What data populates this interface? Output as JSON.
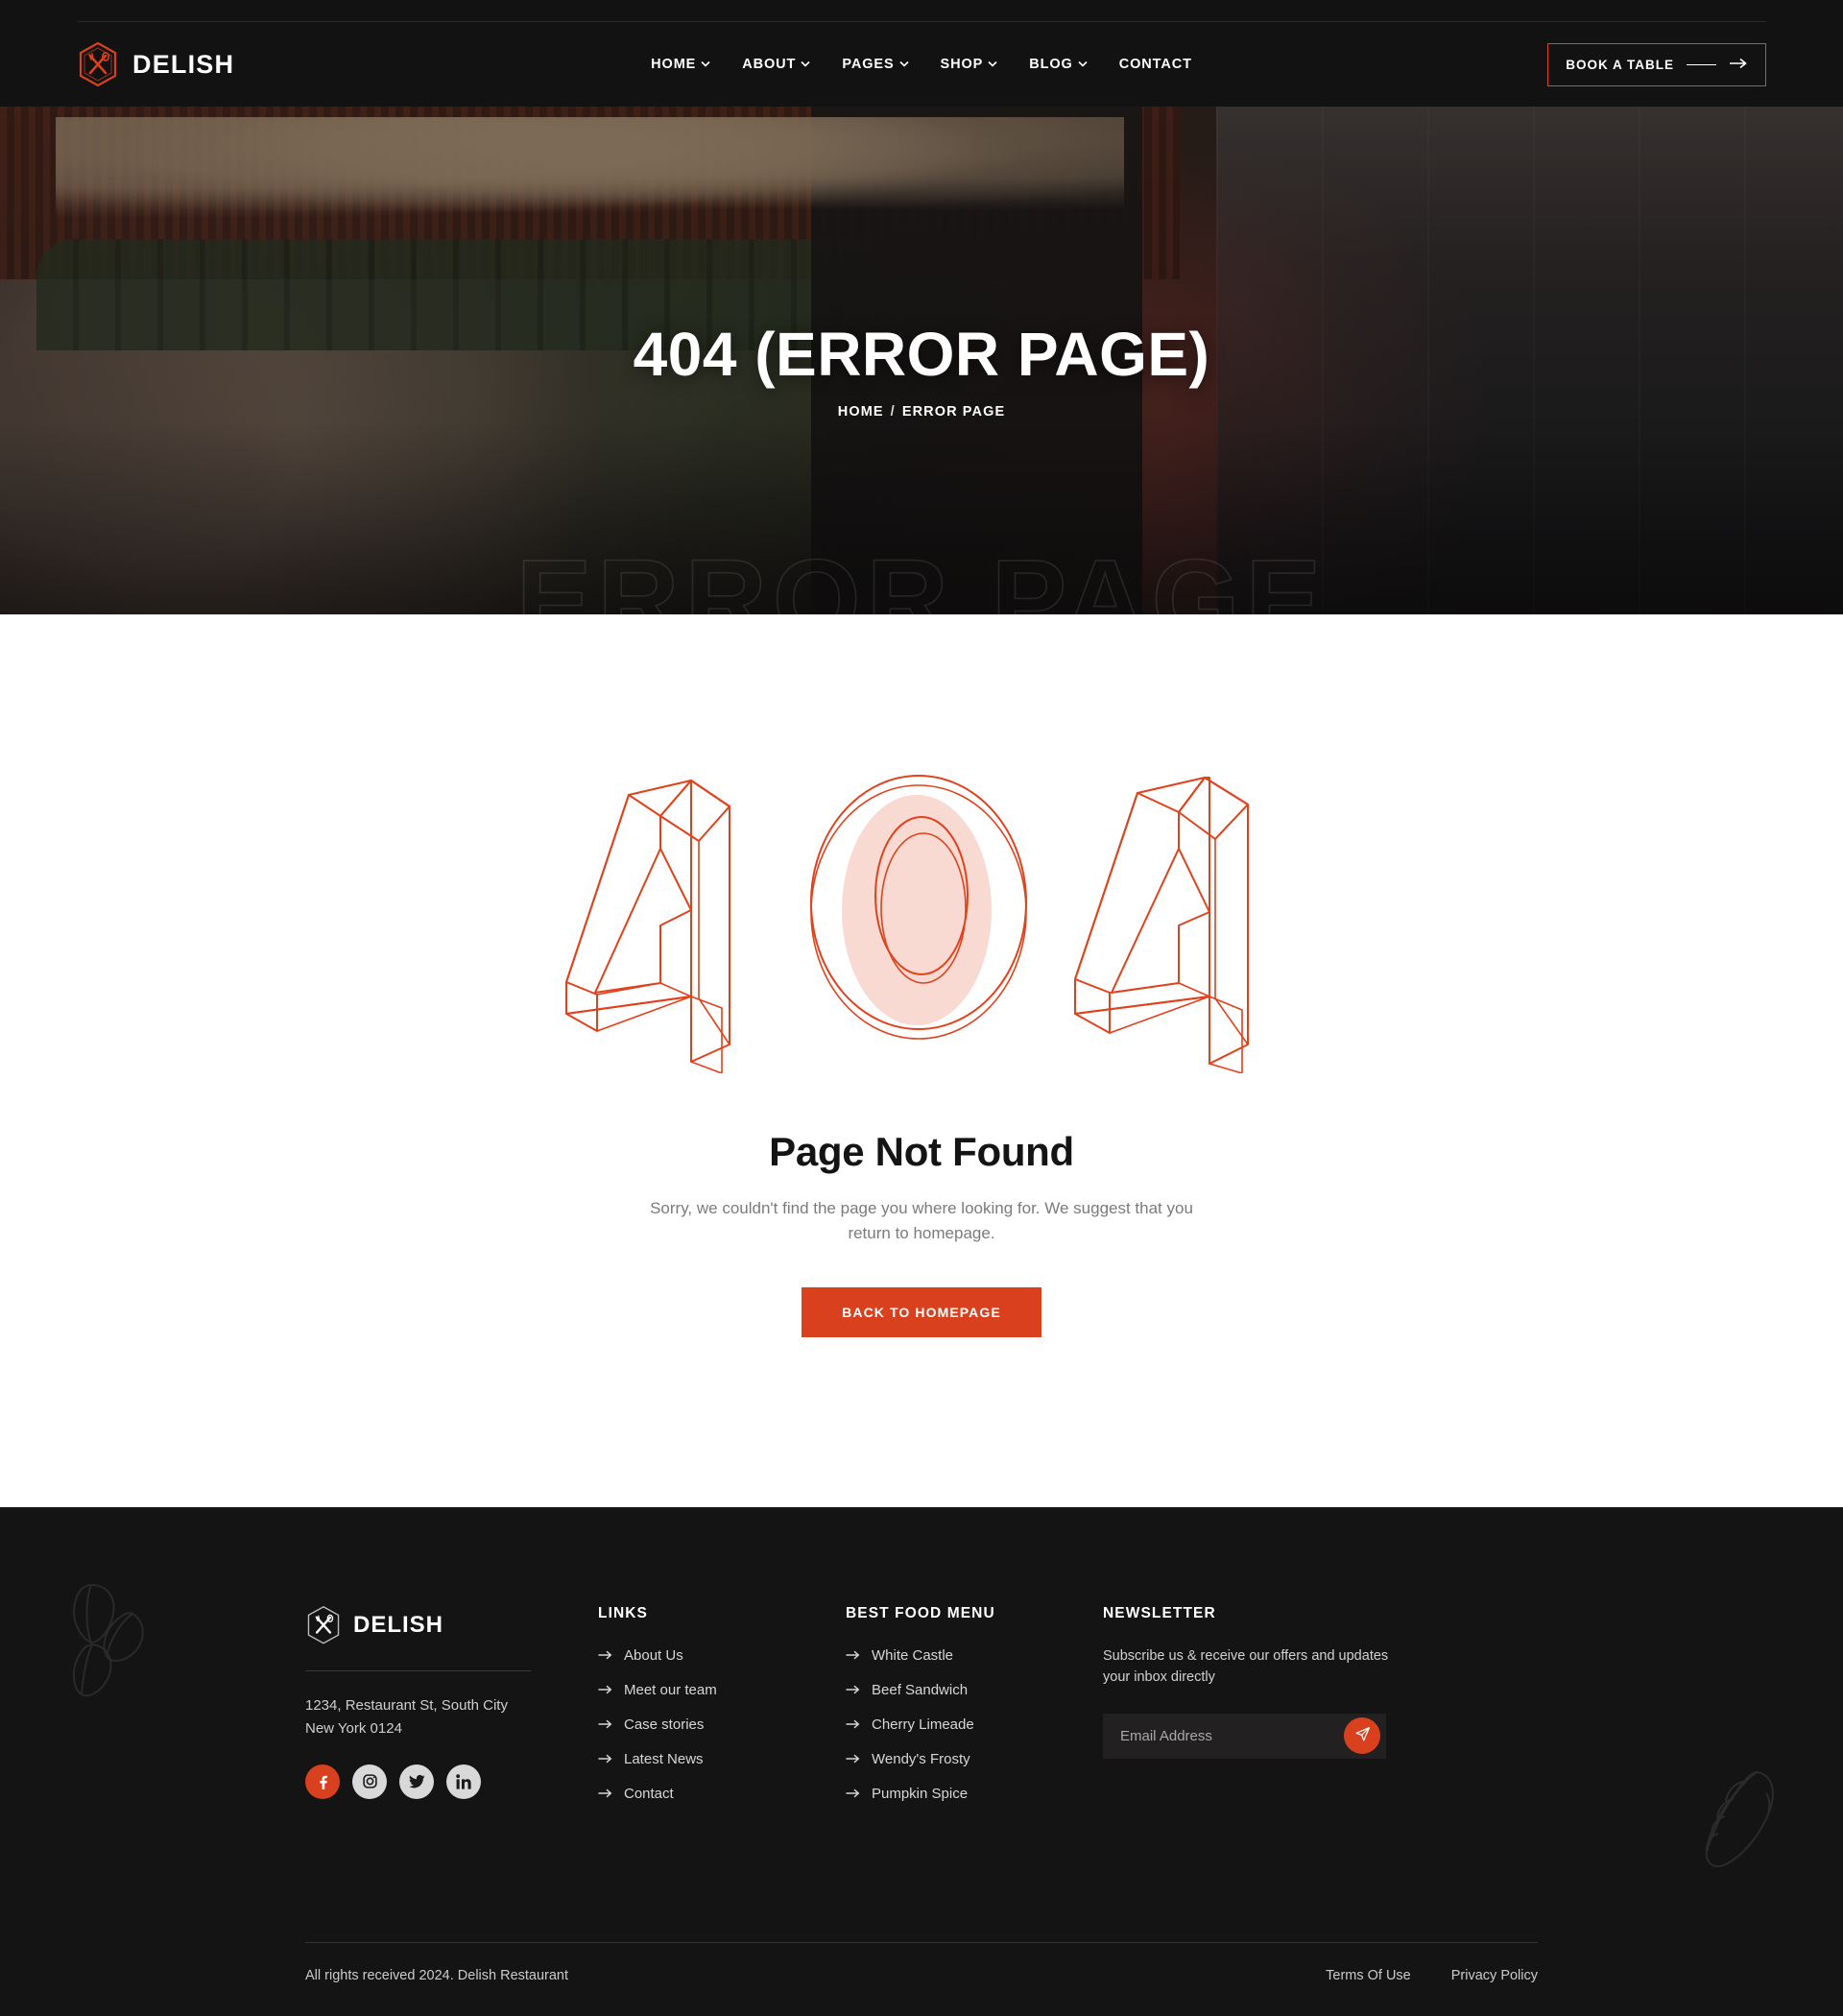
{
  "brand": {
    "name": "DELISH",
    "logo_icon": "hexagon-fork-spoon-icon"
  },
  "header": {
    "nav": [
      {
        "label": "HOME",
        "has_dropdown": true
      },
      {
        "label": "ABOUT",
        "has_dropdown": true
      },
      {
        "label": "PAGES",
        "has_dropdown": true
      },
      {
        "label": "SHOP",
        "has_dropdown": true
      },
      {
        "label": "BLOG",
        "has_dropdown": true
      },
      {
        "label": "CONTACT",
        "has_dropdown": false
      }
    ],
    "cta_label": "BOOK A TABLE",
    "cta_icon": "arrow-right-icon"
  },
  "hero": {
    "title": "404 (ERROR PAGE)",
    "breadcrumb_home": "HOME",
    "breadcrumb_separator": "/",
    "breadcrumb_current": "ERROR PAGE",
    "watermark": "ERROR PAGE"
  },
  "main": {
    "graphic_label": "404",
    "heading": "Page Not Found",
    "description": "Sorry, we couldn't find the page you where looking for. We suggest that you return to homepage.",
    "button_label": "BACK TO HOMEPAGE"
  },
  "footer": {
    "address_line1": "1234, Restaurant St, South City",
    "address_line2": "New York 0124",
    "socials": [
      {
        "name": "facebook-icon",
        "active": true
      },
      {
        "name": "instagram-icon",
        "active": false
      },
      {
        "name": "twitter-icon",
        "active": false
      },
      {
        "name": "linkedin-icon",
        "active": false
      }
    ],
    "links": {
      "title": "LINKS",
      "items": [
        "About Us",
        "Meet our team",
        "Case stories",
        "Latest News",
        "Contact"
      ]
    },
    "menu": {
      "title": "BEST FOOD MENU",
      "items": [
        "White Castle",
        "Beef Sandwich",
        "Cherry Limeade",
        "Wendy's Frosty",
        "Pumpkin Spice"
      ]
    },
    "newsletter": {
      "title": "NEWSLETTER",
      "text": "Subscribe us & receive our offers and updates your inbox directly",
      "placeholder": "Email Address",
      "value": "",
      "submit_icon": "paper-plane-icon"
    },
    "copyright": "All rights received 2024. Delish Restaurant",
    "legal": [
      "Terms Of Use",
      "Privacy Policy"
    ],
    "decorations": [
      "coffee-beans-icon",
      "bread-loaf-icon"
    ]
  },
  "colors": {
    "accent": "#d9411e",
    "dark": "#141414",
    "header_dark": "#121212",
    "text_muted": "#7b7b7b"
  }
}
